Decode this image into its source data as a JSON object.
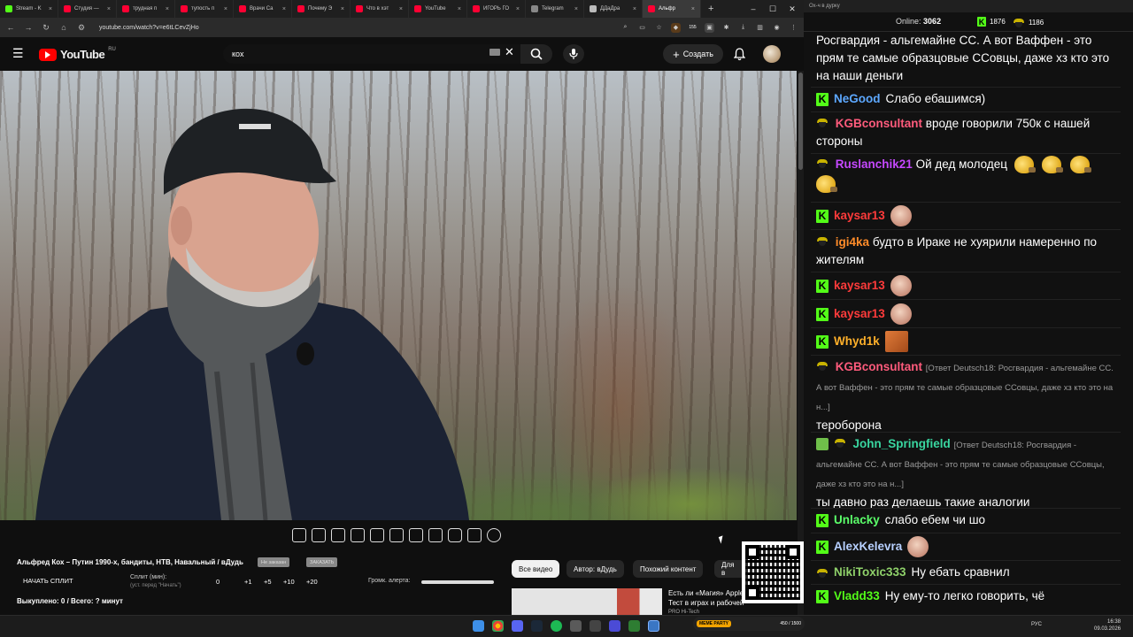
{
  "browser": {
    "tabs": [
      {
        "label": "Stream - K",
        "color": "#53fc18"
      },
      {
        "label": "Студия —",
        "color": "#ff0033"
      },
      {
        "label": "трудная п",
        "color": "#ff0033"
      },
      {
        "label": "тупость п",
        "color": "#ff0033"
      },
      {
        "label": "Врачи Са",
        "color": "#ff0033"
      },
      {
        "label": "Почему Э",
        "color": "#ff0033"
      },
      {
        "label": "Что в хэт",
        "color": "#ff0033"
      },
      {
        "label": "YouTube",
        "color": "#ff0033"
      },
      {
        "label": "ИГОРЬ ГО",
        "color": "#ff0033"
      },
      {
        "label": "Telegram",
        "color": "#888888"
      },
      {
        "label": "ДДаДра",
        "color": "#bbbbbb"
      },
      {
        "label": "Альфр",
        "color": "#ff0033"
      }
    ],
    "url": "youtube.com/watch?v=e6tLCevZjHo",
    "ext_badges": [
      "155",
      "2"
    ]
  },
  "youtube": {
    "logo_text": "YouTube",
    "logo_region": "RU",
    "search_value": "кох",
    "create_label": "Создать",
    "colors": {
      "brand": "#ff0000",
      "bg": "#0f0f0f"
    }
  },
  "player_bar": {
    "icons": [
      "repeat-icon",
      "broadcast-icon",
      "film-settings-icon",
      "clapper-icon",
      "resize-icon",
      "list-icon",
      "speed-icon",
      "add-icon",
      "camera-icon",
      "flask-icon",
      "gear-icon"
    ]
  },
  "below": {
    "title": "Альфред Кох – Путин 1990-х, бандиты, НТВ, Навальный / вДудь",
    "chip1": "Не заказан",
    "chip2": "ЗАКАЗАТЬ",
    "split_start": "НАЧАТЬ СПЛИТ",
    "split_label": "Сплит (мин):",
    "split_sub": "(уст. перед \"Начать\")",
    "split_values": [
      "0",
      "+1",
      "+5",
      "+10",
      "+20"
    ],
    "alert_label": "Громк. алерта:",
    "bought": "Выкуплено: 0 / Всего: ? минут",
    "filters": [
      "Все видео",
      "Автор: вДудь",
      "Похожий контент",
      "Для в"
    ],
    "rec_title": "Есть ли «Магия» Apple? Тест в играх и рабочей",
    "rec_channel": "PRO Hi-Tech"
  },
  "chat": {
    "titlebar": "Ох-ч в дурку",
    "online_label": "Online:",
    "online_count": "3062",
    "k_count": "1876",
    "s_count": "1186",
    "messages": [
      {
        "user": "",
        "text": "Росгвардия - альгемайне СС. А вот Ваффен - это прям те самые образцовые ССовцы, даже хз кто это на наши деньги"
      },
      {
        "user": "NeGood",
        "color": "#5da8ff",
        "text": "Слабо ебашимся)"
      },
      {
        "user": "KGBconsultant",
        "color": "#ff5b7c",
        "text": "вроде говорили 750к с нашей стороны"
      },
      {
        "user": "Ruslanchik21",
        "color": "#c548ff",
        "text": "Ой дед молодец"
      },
      {
        "user": "kaysar13",
        "color": "#ff3b3b",
        "text": ""
      },
      {
        "user": "igi4ka",
        "color": "#ff8c2a",
        "text": "будто в Ираке не хуярили намеренно по жителям"
      },
      {
        "user": "kaysar13",
        "color": "#ff3b3b",
        "text": ""
      },
      {
        "user": "kaysar13",
        "color": "#ff3b3b",
        "text": ""
      },
      {
        "user": "Whyd1k",
        "color": "#ffb02a",
        "text": ""
      },
      {
        "user": "KGBconsultant",
        "color": "#ff5b7c",
        "reply": "[Ответ Deutsch18: Росгвардия - альгемайне СС. А вот Ваффен - это прям те самые образцовые ССовцы, даже хз кто это на н...]",
        "text": "тероборона"
      },
      {
        "user": "John_Springfield",
        "color": "#39d6a0",
        "reply": "[Ответ Deutsch18: Росгвардия - альгемайне СС. А вот Ваффен - это прям те самые образцовые ССовцы, даже хз кто это на н...]",
        "text": "ты давно раз делаешь такие аналогии"
      },
      {
        "user": "Unlacky",
        "color": "#5bff6a",
        "text": "слабо ебем чи шо"
      },
      {
        "user": "AlexKelevra",
        "color": "#b7d0ff",
        "text": ""
      },
      {
        "user": "NikiToxic333",
        "color": "#8fd16a",
        "text": "Ну ебать сравнил"
      },
      {
        "user": "Vladd33",
        "color": "#53fc18",
        "text": "Ну ему-то легко говорить, чё"
      }
    ]
  },
  "taskbar": {
    "widget_label": "MEME PARTY",
    "widget_count": "450 / 1500",
    "lang": "РУС",
    "time": "16:38",
    "date": "09.03.2026"
  }
}
